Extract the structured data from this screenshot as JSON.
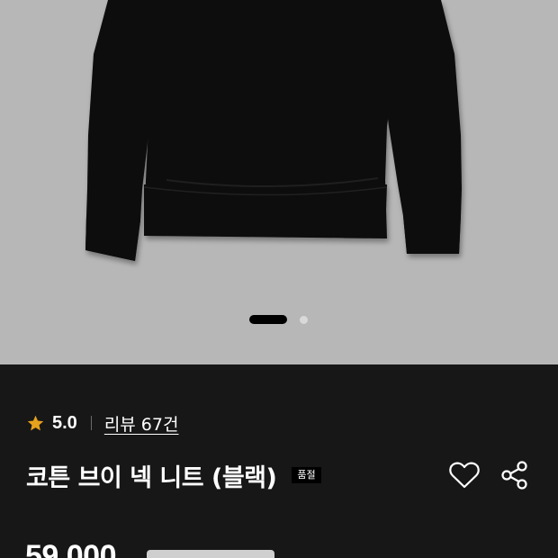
{
  "product": {
    "rating": "5.0",
    "review_link": "리뷰 67건",
    "title": "코튼 브이 넥 니트 (블랙)",
    "status_badge": "품절",
    "price": "59,000"
  },
  "gallery": {
    "total_images": 2,
    "active_index": 1
  },
  "icons": {
    "rating": "star-icon",
    "wishlist": "heart-icon",
    "share": "share-icon"
  },
  "colors": {
    "hero_background": "#b7b7b7",
    "info_background": "#171717",
    "star": "#e6a21d",
    "badge_background": "#000000"
  }
}
